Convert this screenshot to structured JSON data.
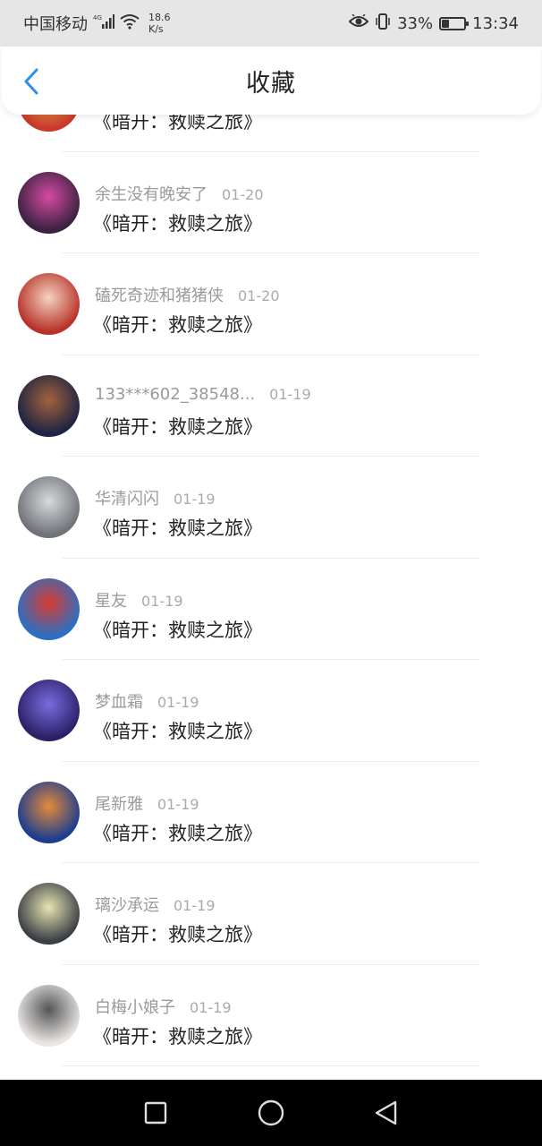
{
  "status_bar": {
    "carrier": "中国移动",
    "network": "4G",
    "speed_value": "18.6",
    "speed_unit": "K/s",
    "battery_percent": "33%",
    "battery_level": 0.33,
    "time": "13:34",
    "icons": [
      "signal-icon",
      "wifi-icon",
      "eye-icon",
      "vibrate-icon",
      "battery-icon"
    ]
  },
  "header": {
    "title": "收藏",
    "back_icon": "chevron-left-icon",
    "accent_color": "#2e8fe6"
  },
  "items": [
    {
      "user": "",
      "date": "",
      "title": "《暗开：救赎之旅》",
      "avatar_colors": [
        "#c9392b",
        "#f0b34a"
      ]
    },
    {
      "user": "余生没有晚安了",
      "date": "01-20",
      "title": "《暗开：救赎之旅》",
      "avatar_colors": [
        "#3a2240",
        "#d64aa3"
      ]
    },
    {
      "user": "磕死奇迹和猪猪侠",
      "date": "01-20",
      "title": "《暗开：救赎之旅》",
      "avatar_colors": [
        "#b83229",
        "#f4d3c0"
      ]
    },
    {
      "user": "133***602_38548...",
      "date": "01-19",
      "title": "《暗开：救赎之旅》",
      "avatar_colors": [
        "#1e2443",
        "#a3623c"
      ]
    },
    {
      "user": "华清闪闪",
      "date": "01-19",
      "title": "《暗开：救赎之旅》",
      "avatar_colors": [
        "#6f7378",
        "#d8dadc"
      ]
    },
    {
      "user": "星友",
      "date": "01-19",
      "title": "《暗开：救赎之旅》",
      "avatar_colors": [
        "#2a6fc4",
        "#d93b2f"
      ]
    },
    {
      "user": "梦血霜",
      "date": "01-19",
      "title": "《暗开：救赎之旅》",
      "avatar_colors": [
        "#2b2166",
        "#7b6be0"
      ]
    },
    {
      "user": "尾新雅",
      "date": "01-19",
      "title": "《暗开：救赎之旅》",
      "avatar_colors": [
        "#1b3d8f",
        "#e58a3a"
      ]
    },
    {
      "user": "璃沙承运",
      "date": "01-19",
      "title": "《暗开：救赎之旅》",
      "avatar_colors": [
        "#3a3f45",
        "#e8e4b0"
      ]
    },
    {
      "user": "白梅小娘子",
      "date": "01-19",
      "title": "《暗开：救赎之旅》",
      "avatar_colors": [
        "#e9e6e4",
        "#555555"
      ]
    }
  ],
  "nav_bar": {
    "icons": [
      "square-recents-icon",
      "circle-home-icon",
      "triangle-back-icon"
    ]
  }
}
